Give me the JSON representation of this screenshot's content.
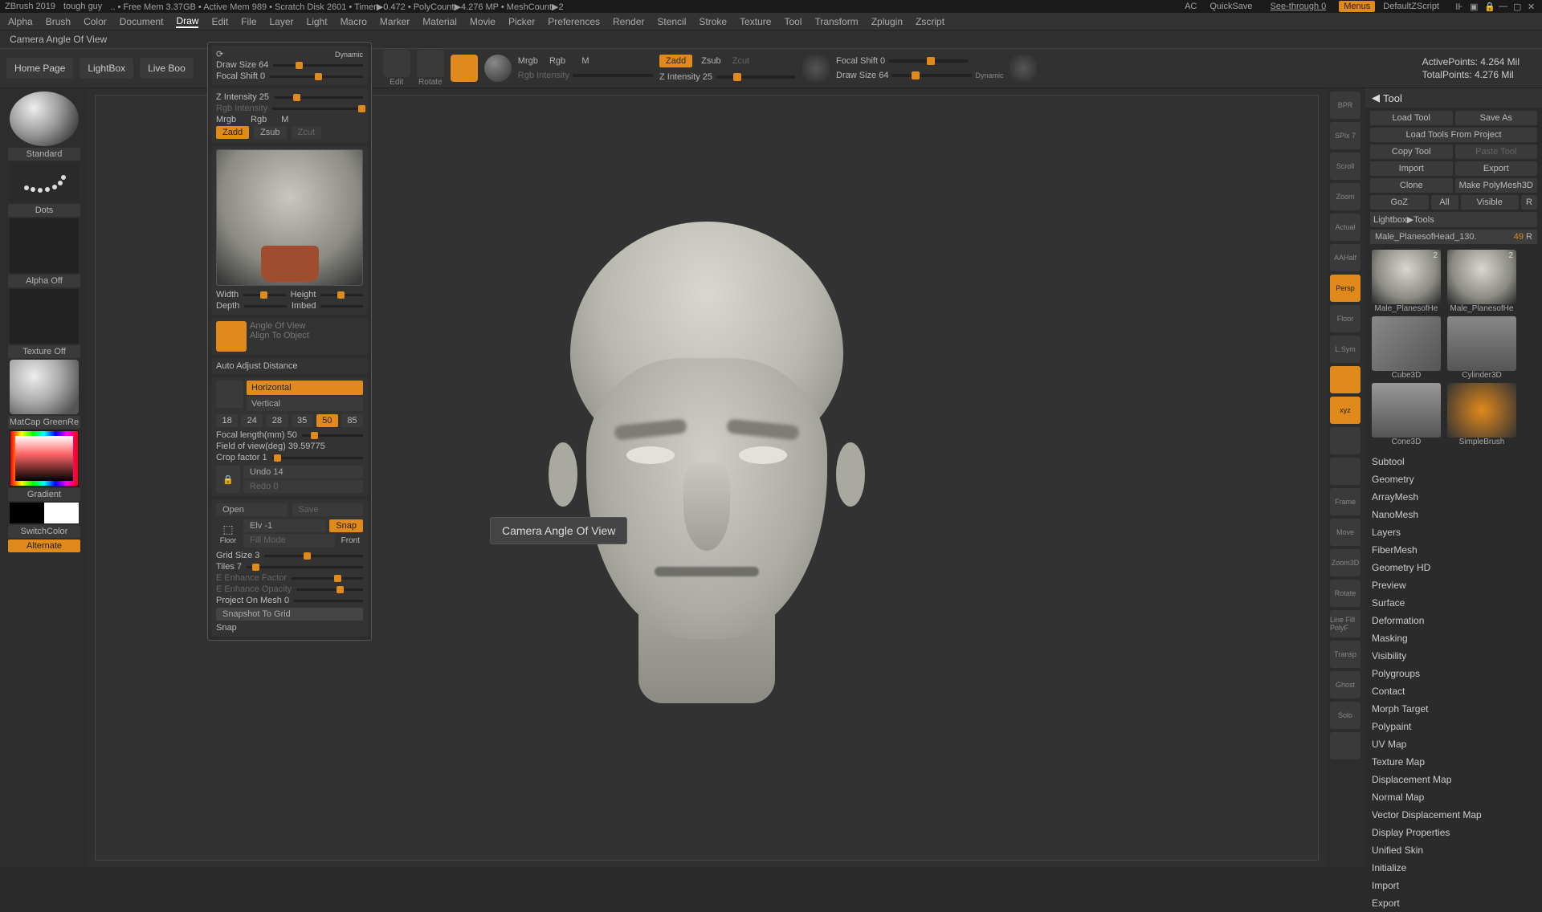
{
  "title": {
    "app": "ZBrush 2019",
    "doc": "tough guy",
    "mem": ".. • Free Mem 3.37GB • Active Mem 989 • Scratch Disk 2601 • Timer▶0.472 • PolyCount▶4.276 MP • MeshCount▶2"
  },
  "titlebar_right": {
    "ac": "AC",
    "quicksave": "QuickSave",
    "seethrough": "See-through  0",
    "menus": "Menus",
    "script": "DefaultZScript"
  },
  "menu": [
    "Alpha",
    "Brush",
    "Color",
    "Document",
    "Draw",
    "Edit",
    "File",
    "Layer",
    "Light",
    "Macro",
    "Marker",
    "Material",
    "Movie",
    "Picker",
    "Preferences",
    "Render",
    "Stencil",
    "Stroke",
    "Texture",
    "Tool",
    "Transform",
    "Zplugin",
    "Zscript"
  ],
  "menu_selected": "Draw",
  "infobar": "Camera Angle Of View",
  "shelf": {
    "home": "Home Page",
    "lightbox": "LightBox",
    "liveboo": "Live Boo",
    "edit": "Edit",
    "rotate": "Rotate"
  },
  "slider1": {
    "mrgb": "Mrgb",
    "rgb": "Rgb",
    "m": "M",
    "rgbint": "Rgb Intensity"
  },
  "slider2": {
    "zadd": "Zadd",
    "zsub": "Zsub",
    "zcut": "Zcut",
    "zint": "Z Intensity 25"
  },
  "slider3": {
    "focal": "Focal Shift 0",
    "draw": "Draw Size 64",
    "dyn": "Dynamic"
  },
  "stats": {
    "active": "ActivePoints: 4.264 Mil",
    "total": "TotalPoints: 4.276 Mil"
  },
  "drawpanel": {
    "drawsize": "Draw Size 64",
    "focal": "Focal Shift 0",
    "dyn": "Dynamic",
    "zint": "Z Intensity 25",
    "rgbint": "Rgb Intensity",
    "mrgb": "Mrgb",
    "rgb": "Rgb",
    "m": "M",
    "zadd": "Zadd",
    "zsub": "Zsub",
    "zcut": "Zcut",
    "width": "Width",
    "height": "Height",
    "depth": "Depth",
    "imbed": "Imbed",
    "aov": "Angle Of View",
    "ato": "Align To Object",
    "aad": "Auto Adjust Distance",
    "horiz": "Horizontal",
    "vert": "Vertical",
    "fls": [
      "18",
      "24",
      "28",
      "35",
      "50",
      "85"
    ],
    "fl_sel": "50",
    "flmm": "Focal length(mm) 50",
    "fov": "Field of view(deg) 39.59775",
    "crop": "Crop factor 1",
    "undo": "Undo 14",
    "redo": "Redo 0",
    "open": "Open",
    "save": "Save",
    "elv": "Elv -1",
    "snap": "Snap",
    "fill": "Fill Mode",
    "front": "Front",
    "floor": "Floor",
    "gridsize": "Grid Size 3",
    "tiles": "Tiles 7",
    "eef": "E Enhance Factor",
    "eeo": "E Enhance Opacity",
    "pom": "Project On Mesh 0",
    "stg": "Snapshot To Grid",
    "snapb": "Snap"
  },
  "tooltip": "Camera Angle Of View",
  "left": {
    "standard": "Standard",
    "dots": "Dots",
    "alphaoff": "Alpha Off",
    "texoff": "Texture Off",
    "matcap": "MatCap GreenRe",
    "gradient": "Gradient",
    "switch": "SwitchColor",
    "alternate": "Alternate"
  },
  "rstrip": [
    {
      "l": "BPR"
    },
    {
      "l": "SPix 7"
    },
    {
      "l": "Scroll"
    },
    {
      "l": "Zoom"
    },
    {
      "l": "Actual"
    },
    {
      "l": "AAHalf"
    },
    {
      "l": "Persp",
      "on": true
    },
    {
      "l": "Floor"
    },
    {
      "l": "L.Sym"
    },
    {
      "l": "",
      "on": true
    },
    {
      "l": "xyz",
      "on": true
    },
    {
      "l": ""
    },
    {
      "l": ""
    },
    {
      "l": "Frame"
    },
    {
      "l": "Move"
    },
    {
      "l": "Zoom3D"
    },
    {
      "l": "Rotate"
    },
    {
      "l": "Line Fill\nPolyF"
    },
    {
      "l": "Transp"
    },
    {
      "l": "Ghost"
    },
    {
      "l": "Solo"
    },
    {
      "l": ""
    }
  ],
  "tool": {
    "hdr": "Tool",
    "row1": [
      "Load Tool",
      "Save As"
    ],
    "row2": [
      "Load Tools From Project"
    ],
    "row3": [
      "Copy Tool",
      "Paste Tool"
    ],
    "row4": [
      "Import",
      "Export"
    ],
    "row5": [
      "Clone",
      "Make PolyMesh3D"
    ],
    "row6": [
      "GoZ",
      "All",
      "Visible",
      "R"
    ],
    "row7": "Lightbox▶Tools",
    "name": "Male_PlanesofHead_130.",
    "name_n": "49",
    "name_r": "R",
    "thumbs": [
      {
        "n": "Male_PlanesofHe",
        "c": "2"
      },
      {
        "n": "Male_PlanesofHe",
        "c": "2"
      },
      {
        "n": "Cube3D"
      },
      {
        "n": "Cylinder3D"
      },
      {
        "n": "Cone3D"
      },
      {
        "n": "SimpleBrush"
      }
    ],
    "sections": [
      "Subtool",
      "Geometry",
      "ArrayMesh",
      "NanoMesh",
      "Layers",
      "FiberMesh",
      "Geometry HD",
      "Preview",
      "Surface",
      "Deformation",
      "Masking",
      "Visibility",
      "Polygroups",
      "Contact",
      "Morph Target",
      "Polypaint",
      "UV Map",
      "Texture Map",
      "Displacement Map",
      "Normal Map",
      "Vector Displacement Map",
      "Display Properties",
      "Unified Skin",
      "Initialize",
      "Import",
      "Export"
    ]
  }
}
